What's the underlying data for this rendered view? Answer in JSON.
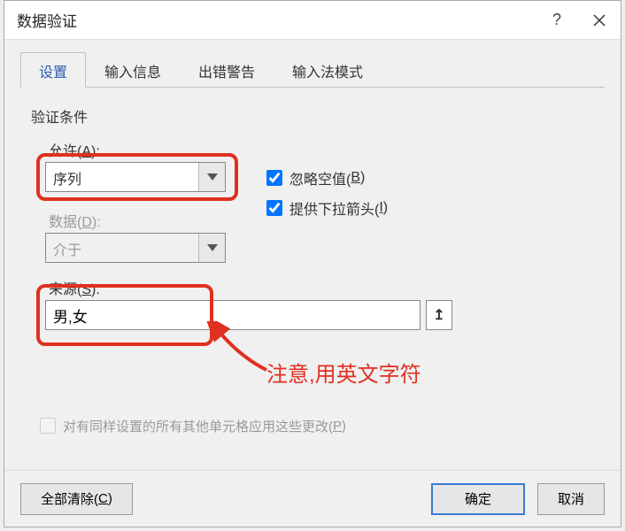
{
  "window": {
    "title": "数据验证"
  },
  "tabs": {
    "settings": "设置",
    "input_msg": "输入信息",
    "error_alert": "出错警告",
    "ime_mode": "输入法模式"
  },
  "section": {
    "criteria": "验证条件"
  },
  "allow": {
    "label_pre": "允许(",
    "label_key": "A",
    "label_post": "):",
    "value": "序列"
  },
  "data": {
    "label_pre": "数据(",
    "label_key": "D",
    "label_post": "):",
    "value": "介于"
  },
  "source": {
    "label_pre": "来源(",
    "label_key": "S",
    "label_post": "):",
    "value": "男,女"
  },
  "checkboxes": {
    "ignore_blank_pre": "忽略空值(",
    "ignore_blank_key": "B",
    "ignore_blank_post": ")",
    "dropdown_pre": "提供下拉箭头(",
    "dropdown_key": "I",
    "dropdown_post": ")",
    "apply_pre": "对有同样设置的所有其他单元格应用这些更改(",
    "apply_key": "P",
    "apply_post": ")"
  },
  "annotation": {
    "text": "注意,用英文字符"
  },
  "buttons": {
    "clear_pre": "全部清除(",
    "clear_key": "C",
    "clear_post": ")",
    "ok": "确定",
    "cancel": "取消"
  }
}
